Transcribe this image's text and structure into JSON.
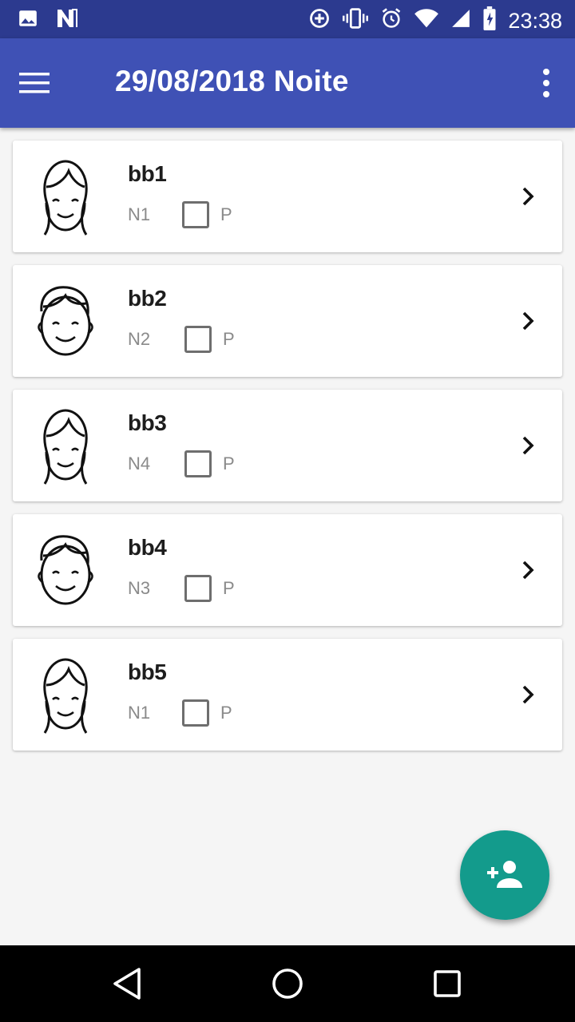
{
  "status_bar": {
    "time": "23:38",
    "icons": [
      "image-icon",
      "n-notification-icon",
      "data-saver-icon",
      "vibrate-icon",
      "alarm-icon",
      "wifi-icon",
      "cell-signal-icon",
      "battery-charging-icon"
    ]
  },
  "app_bar": {
    "title": "29/08/2018 Noite",
    "menu_icon": "hamburger-menu-icon",
    "overflow_icon": "more-vert-icon"
  },
  "children": [
    {
      "name": "bb1",
      "level": "N1",
      "present_label": "P",
      "present": false,
      "avatar": "girl-face-icon"
    },
    {
      "name": "bb2",
      "level": "N2",
      "present_label": "P",
      "present": false,
      "avatar": "boy-face-icon"
    },
    {
      "name": "bb3",
      "level": "N4",
      "present_label": "P",
      "present": false,
      "avatar": "girl-face-icon"
    },
    {
      "name": "bb4",
      "level": "N3",
      "present_label": "P",
      "present": false,
      "avatar": "boy-face-icon"
    },
    {
      "name": "bb5",
      "level": "N1",
      "present_label": "P",
      "present": false,
      "avatar": "girl-face-icon"
    }
  ],
  "fab": {
    "icon": "add-person-icon"
  },
  "nav_bar": {
    "icons": [
      "back-icon",
      "home-icon",
      "recents-icon"
    ]
  },
  "colors": {
    "status_bar": "#2c3a8f",
    "app_bar": "#3f51b5",
    "fab": "#139b8c",
    "background": "#f5f5f5"
  }
}
